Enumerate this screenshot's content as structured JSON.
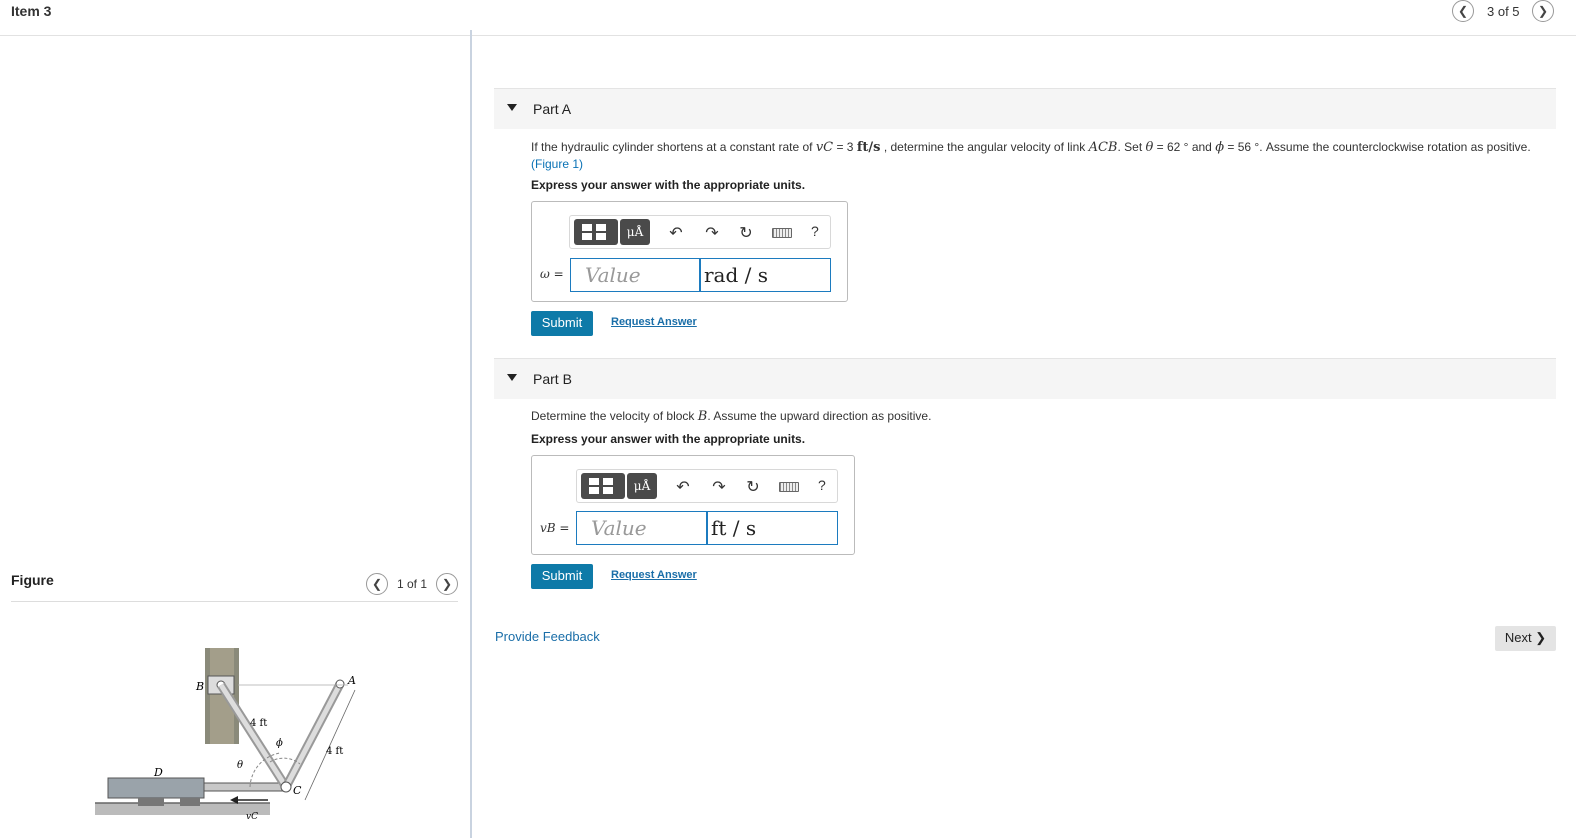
{
  "header": {
    "item_title": "Item 3",
    "pager_text": "3 of 5",
    "prev_icon": "chevron-left-icon",
    "next_icon": "chevron-right-icon"
  },
  "figure_panel": {
    "label": "Figure",
    "pager_text": "1 of 1",
    "labels": {
      "a": "A",
      "b": "B",
      "c": "C",
      "d": "D",
      "len1": "4 ft",
      "len2": "4 ft",
      "theta": "θ",
      "phi": "ϕ",
      "vc": "vC"
    }
  },
  "toolbar": {
    "mu_label": "μÅ",
    "undo_icon": "↶",
    "redo_icon": "↷",
    "reset_icon": "↻",
    "help": "?"
  },
  "part_a": {
    "title": "Part A",
    "q_pre": "If the hydraulic cylinder shortens at a constant rate of ",
    "q_v": "vC",
    "q_rate": " = 3 ",
    "q_unit": "ft/s",
    "q_mid": " , determine the angular velocity of link ",
    "q_link": "ACB",
    "q_set": ". Set ",
    "q_theta": "θ",
    "q_theta_val": " = 62 ° and ",
    "q_phi": "ϕ",
    "q_phi_val": " = 56 °. Assume the counterclockwise rotation as positive.",
    "q_fig_link": "(Figure 1)",
    "express": "Express your answer with the appropriate units.",
    "var_label": "ω =",
    "value_placeholder": "Value",
    "unit_value": "rad / s",
    "submit": "Submit",
    "request": "Request Answer"
  },
  "part_b": {
    "title": "Part B",
    "q_pre": "Determine the velocity of block ",
    "q_block": "B",
    "q_post": ". Assume the upward direction as positive.",
    "express": "Express your answer with the appropriate units.",
    "var_label": "vB =",
    "value_placeholder": "Value",
    "unit_value": "ft / s",
    "submit": "Submit",
    "request": "Request Answer"
  },
  "footer": {
    "feedback": "Provide Feedback",
    "next": "Next ❯"
  }
}
